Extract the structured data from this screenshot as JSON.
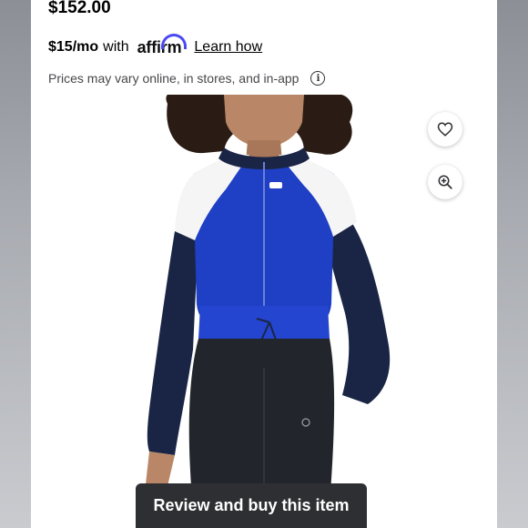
{
  "product": {
    "price": "$152.00",
    "affirm": {
      "monthly": "$15/mo",
      "with": "with",
      "brand": "affirm",
      "learn_how": "Learn how"
    },
    "disclaimer": "Prices may vary online, in stores, and in-app"
  },
  "image": {
    "favorite_icon": "heart-icon",
    "zoom_icon": "zoom-in-icon"
  },
  "cta": {
    "label": "Review and buy this item"
  },
  "colors": {
    "cta_bg": "#2e2f32",
    "affirm_arc": "#4a4af4",
    "jacket_blue": "#1f3fc4",
    "jacket_navy": "#1a2545"
  }
}
